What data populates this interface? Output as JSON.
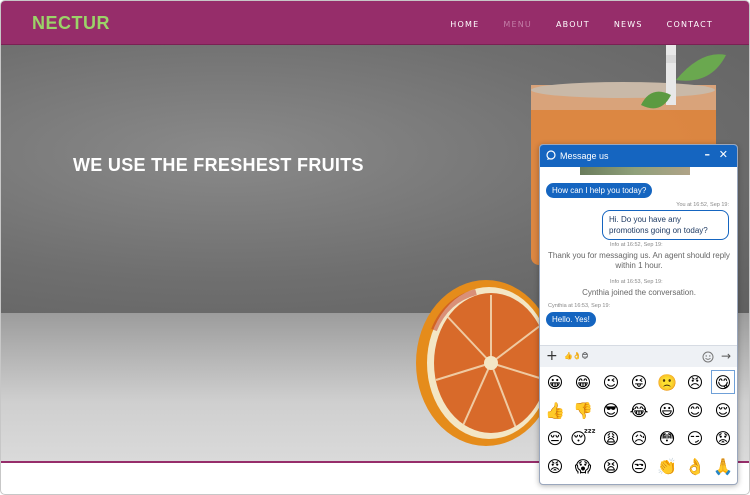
{
  "nav": {
    "logo": "NECTUR",
    "items": [
      {
        "label": "HOME",
        "active": false
      },
      {
        "label": "MENU",
        "active": true
      },
      {
        "label": "ABOUT",
        "active": false
      },
      {
        "label": "NEWS",
        "active": false
      },
      {
        "label": "CONTACT",
        "active": false
      }
    ]
  },
  "hero": {
    "headline": "WE USE THE FRESHEST FRUITS"
  },
  "colors": {
    "brand": "#962d6a",
    "logo": "#9bd368",
    "chat_blue": "#1565c0"
  },
  "chat": {
    "title": "Message us",
    "messages": {
      "q1": "How can I help you today?",
      "you_meta": "You at 16:52, Sep 19:",
      "you_text": "Hi. Do you have any promotions going on today?",
      "info1_meta": "Info at 16:52, Sep 19:",
      "info1_text": "Thank you for messaging us. An agent should reply within 1 hour.",
      "info2_meta": "Info at 16:53, Sep 19:",
      "info2_text": "Cynthia joined the conversation.",
      "cynthia_meta": "Cynthia at 16:53, Sep 19:",
      "cynthia_text": "Hello. Yes!"
    },
    "input_value": "👍👌😊",
    "emojis": [
      "😀",
      "😁",
      "😉",
      "😜",
      "🙁",
      "😠",
      "😋",
      "👍",
      "👎",
      "😎",
      "😂",
      "😃",
      "😊",
      "😌",
      "😔",
      "😴",
      "😩",
      "😥",
      "😳",
      "😏",
      "😟",
      "😡",
      "😱",
      "😫",
      "😒",
      "👏",
      "👌",
      "🙏"
    ],
    "selected_emoji_index": 6
  }
}
